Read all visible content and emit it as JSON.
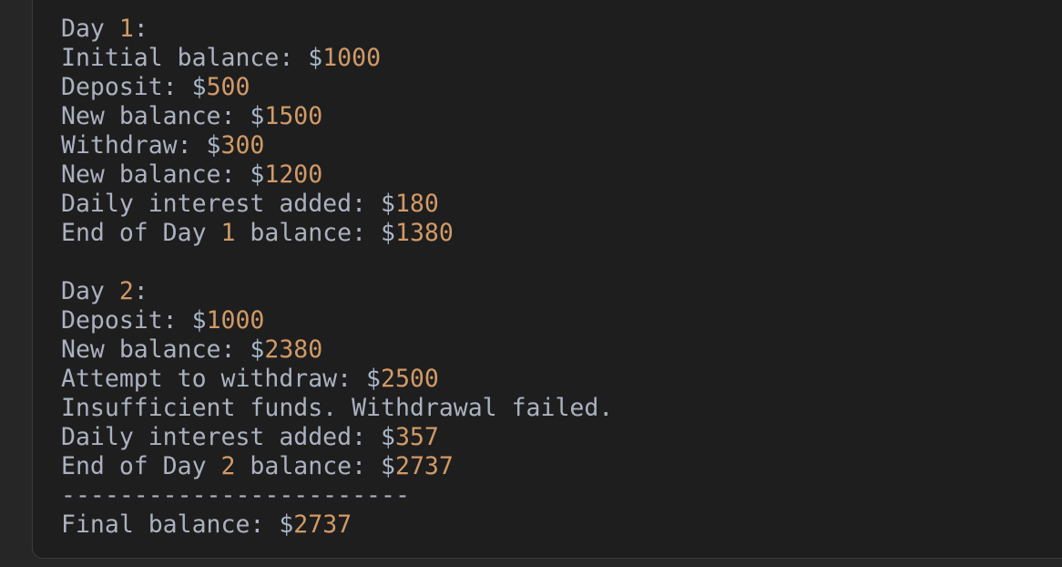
{
  "colors": {
    "text": "#abb2bf",
    "number": "#d19a66",
    "background": "#1e1e1f"
  },
  "lines": [
    [
      {
        "t": "Day ",
        "c": "text"
      },
      {
        "t": "1",
        "c": "num"
      },
      {
        "t": ":",
        "c": "text"
      }
    ],
    [
      {
        "t": "Initial balance: ",
        "c": "text"
      },
      {
        "t": "$",
        "c": "sym"
      },
      {
        "t": "1000",
        "c": "num"
      }
    ],
    [
      {
        "t": "Deposit: ",
        "c": "text"
      },
      {
        "t": "$",
        "c": "sym"
      },
      {
        "t": "500",
        "c": "num"
      }
    ],
    [
      {
        "t": "New balance: ",
        "c": "text"
      },
      {
        "t": "$",
        "c": "sym"
      },
      {
        "t": "1500",
        "c": "num"
      }
    ],
    [
      {
        "t": "Withdraw: ",
        "c": "text"
      },
      {
        "t": "$",
        "c": "sym"
      },
      {
        "t": "300",
        "c": "num"
      }
    ],
    [
      {
        "t": "New balance: ",
        "c": "text"
      },
      {
        "t": "$",
        "c": "sym"
      },
      {
        "t": "1200",
        "c": "num"
      }
    ],
    [
      {
        "t": "Daily interest added: ",
        "c": "text"
      },
      {
        "t": "$",
        "c": "sym"
      },
      {
        "t": "180",
        "c": "num"
      }
    ],
    [
      {
        "t": "End of Day ",
        "c": "text"
      },
      {
        "t": "1",
        "c": "num"
      },
      {
        "t": " balance: ",
        "c": "text"
      },
      {
        "t": "$",
        "c": "sym"
      },
      {
        "t": "1380",
        "c": "num"
      }
    ],
    [],
    [
      {
        "t": "Day ",
        "c": "text"
      },
      {
        "t": "2",
        "c": "num"
      },
      {
        "t": ":",
        "c": "text"
      }
    ],
    [
      {
        "t": "Deposit: ",
        "c": "text"
      },
      {
        "t": "$",
        "c": "sym"
      },
      {
        "t": "1000",
        "c": "num"
      }
    ],
    [
      {
        "t": "New balance: ",
        "c": "text"
      },
      {
        "t": "$",
        "c": "sym"
      },
      {
        "t": "2380",
        "c": "num"
      }
    ],
    [
      {
        "t": "Attempt to withdraw: ",
        "c": "text"
      },
      {
        "t": "$",
        "c": "sym"
      },
      {
        "t": "2500",
        "c": "num"
      }
    ],
    [
      {
        "t": "Insufficient funds. Withdrawal failed.",
        "c": "text"
      }
    ],
    [
      {
        "t": "Daily interest added: ",
        "c": "text"
      },
      {
        "t": "$",
        "c": "sym"
      },
      {
        "t": "357",
        "c": "num"
      }
    ],
    [
      {
        "t": "End of Day ",
        "c": "text"
      },
      {
        "t": "2",
        "c": "num"
      },
      {
        "t": " balance: ",
        "c": "text"
      },
      {
        "t": "$",
        "c": "sym"
      },
      {
        "t": "2737",
        "c": "num"
      }
    ],
    [
      {
        "t": "------------------------",
        "c": "text"
      }
    ],
    [
      {
        "t": "Final balance: ",
        "c": "text"
      },
      {
        "t": "$",
        "c": "sym"
      },
      {
        "t": "2737",
        "c": "num"
      }
    ]
  ]
}
